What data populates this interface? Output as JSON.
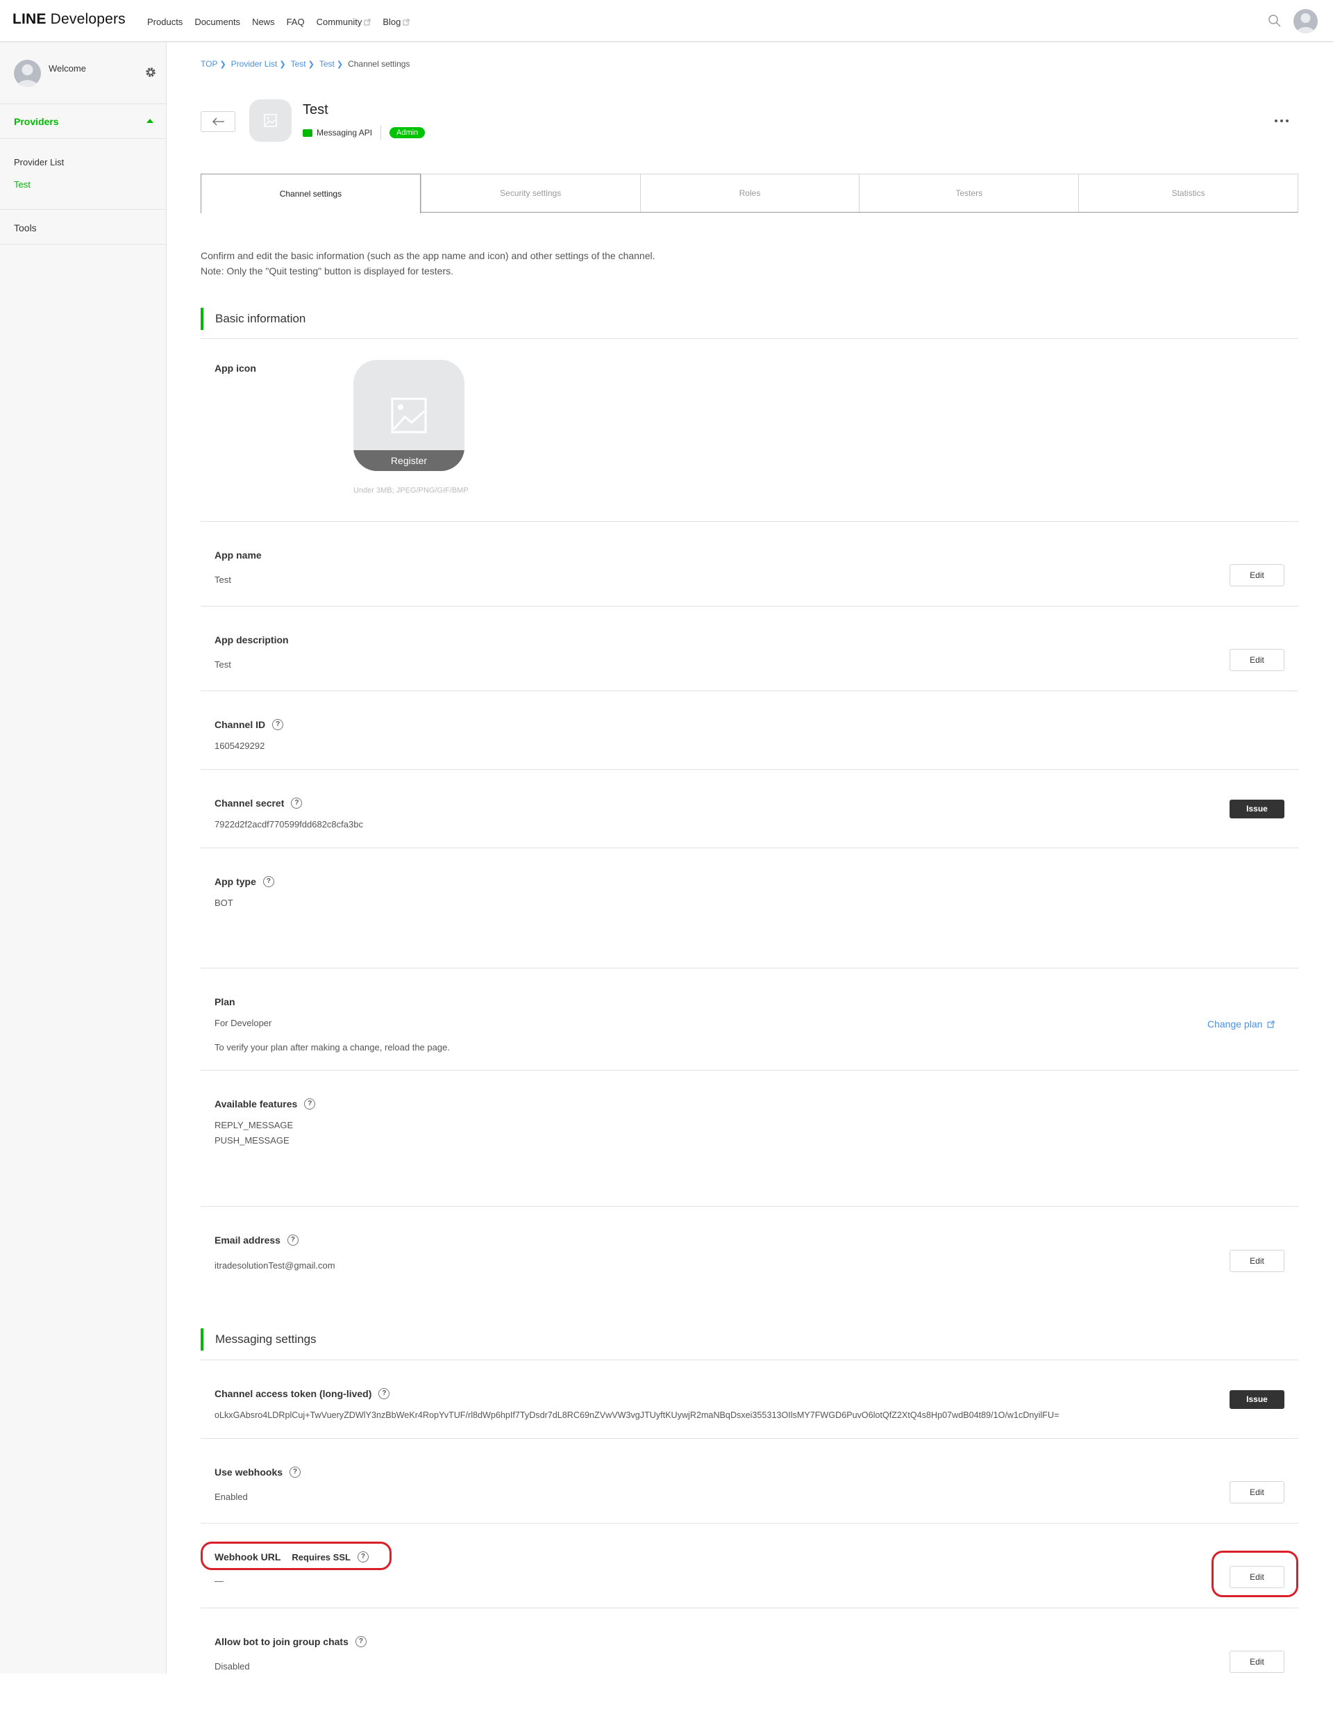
{
  "header": {
    "logo_line": "LINE",
    "logo_dev": "Developers",
    "nav": [
      {
        "label": "Products"
      },
      {
        "label": "Documents"
      },
      {
        "label": "News"
      },
      {
        "label": "FAQ"
      },
      {
        "label": "Community",
        "external": true
      },
      {
        "label": "Blog",
        "external": true
      }
    ]
  },
  "sidebar": {
    "welcome": "Welcome",
    "providers_label": "Providers",
    "items": [
      {
        "label": "Provider List"
      },
      {
        "label": "Test"
      }
    ],
    "tools_label": "Tools"
  },
  "breadcrumb": {
    "items": [
      "TOP",
      "Provider List",
      "Test",
      "Test"
    ],
    "current": "Channel settings"
  },
  "channel": {
    "name": "Test",
    "type": "Messaging API",
    "role_badge": "Admin"
  },
  "tabs": [
    {
      "label": "Channel settings",
      "active": true
    },
    {
      "label": "Security settings",
      "active": false
    },
    {
      "label": "Roles",
      "active": false
    },
    {
      "label": "Testers",
      "active": false
    },
    {
      "label": "Statistics",
      "active": false
    }
  ],
  "intro": {
    "line1": "Confirm and edit the basic information (such as the app name and icon) and other settings of the channel.",
    "line2": "Note: Only the \"Quit testing\" button is displayed for testers."
  },
  "basic": {
    "title": "Basic information",
    "app_icon": {
      "label": "App icon",
      "register_label": "Register",
      "note": "Under 3MB; JPEG/PNG/GIF/BMP"
    },
    "app_name": {
      "label": "App name",
      "value": "Test",
      "button": "Edit"
    },
    "app_description": {
      "label": "App description",
      "value": "Test",
      "button": "Edit"
    },
    "channel_id": {
      "label": "Channel ID",
      "value": "1605429292"
    },
    "channel_secret": {
      "label": "Channel secret",
      "value": "7922d2f2acdf770599fdd682c8cfa3bc",
      "button": "Issue"
    },
    "app_type": {
      "label": "App type",
      "value": "BOT"
    },
    "plan": {
      "label": "Plan",
      "value": "For Developer",
      "note": "To verify your plan after making a change, reload the page.",
      "link": "Change plan"
    },
    "available_features": {
      "label": "Available features",
      "values": [
        "REPLY_MESSAGE",
        "PUSH_MESSAGE"
      ]
    },
    "email": {
      "label": "Email address",
      "value": "itradesolutionTest@gmail.com",
      "button": "Edit"
    }
  },
  "messaging": {
    "title": "Messaging settings",
    "access_token": {
      "label": "Channel access token (long-lived)",
      "value": "oLkxGAbsro4LDRplCuj+TwVueryZDWlY3nzBbWeKr4RopYvTUF/rl8dWp6hpIf7TyDsdr7dL8RC69nZVwVW3vgJTUyftKUywjR2maNBqDsxei355313OIlsMY7FWGD6PuvO6lotQfZ2XtQ4s8Hp07wdB04t89/1O/w1cDnyilFU=",
      "button": "Issue"
    },
    "use_webhooks": {
      "label": "Use webhooks",
      "value": "Enabled",
      "button": "Edit"
    },
    "webhook_url": {
      "label": "Webhook URL",
      "requirement": "Requires SSL",
      "value": "—",
      "button": "Edit"
    },
    "group_chats": {
      "label": "Allow bot to join group chats",
      "value": "Disabled",
      "button": "Edit"
    }
  },
  "colors": {
    "brand_green": "#00b900",
    "link_blue": "#4a90e2",
    "highlight_red": "#d81f2a"
  }
}
